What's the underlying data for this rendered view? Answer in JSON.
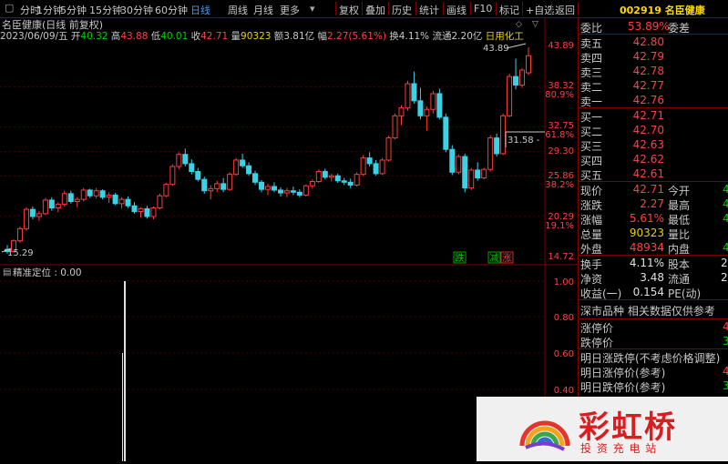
{
  "toolbar": {
    "periods": [
      "分时",
      "1分钟",
      "5分钟",
      "15分钟",
      "30分钟",
      "60分钟",
      "日线",
      "周线",
      "月线",
      "更多"
    ],
    "active_period": "日线",
    "tools": [
      "复权",
      "叠加",
      "历史",
      "统计",
      "画线",
      "F10",
      "标记",
      "+自选",
      "返回"
    ]
  },
  "stock": {
    "code": "002919",
    "name": "名臣健康"
  },
  "chart": {
    "title": "名臣健康(日线 前复权)",
    "info": {
      "date": "2023/06/09/五",
      "open_label": "开",
      "open": "40.32",
      "high_label": "高",
      "high": "43.88",
      "low_label": "低",
      "low": "40.01",
      "close_label": "收",
      "close": "42.71",
      "vol_label": "量",
      "vol": "90323",
      "amount_label": "额",
      "amount": "3.81亿",
      "change_label": "幅",
      "change": "2.27(5.61%)",
      "turnover_label": "换",
      "turnover": "4.11%",
      "float_label": "流通",
      "float": "2.20亿",
      "sector": "日用化工"
    },
    "price_axis": [
      "43.89",
      "38.32",
      "80.9%",
      "32.75",
      "61.8%",
      "29.30",
      "25.86",
      "38.2%",
      "20.29",
      "19.1%",
      "14.72"
    ],
    "high_marker": "43.89",
    "low_marker": "15.29",
    "crosshair_label": "31.58 - ",
    "tags": [
      "跌",
      "减",
      "涨"
    ],
    "indicator_title": "精准定位 : 0.00",
    "indicator_axis": [
      "1.00",
      "0.80",
      "0.60",
      "0.40"
    ]
  },
  "chart_data": {
    "type": "candlestick",
    "y_range": [
      14.72,
      43.89
    ],
    "candles": [
      [
        15.6,
        16.2,
        15.0,
        15.3
      ],
      [
        15.3,
        17.0,
        15.2,
        16.8
      ],
      [
        16.8,
        18.8,
        16.5,
        18.5
      ],
      [
        18.5,
        21.5,
        18.2,
        21.2
      ],
      [
        21.2,
        21.6,
        19.8,
        20.2
      ],
      [
        20.2,
        21.0,
        19.6,
        20.6
      ],
      [
        20.6,
        22.8,
        20.4,
        22.5
      ],
      [
        22.5,
        22.9,
        21.0,
        21.4
      ],
      [
        21.4,
        22.2,
        20.8,
        21.9
      ],
      [
        21.9,
        23.8,
        21.6,
        23.4
      ],
      [
        23.4,
        23.8,
        22.0,
        22.3
      ],
      [
        22.3,
        22.9,
        21.5,
        22.6
      ],
      [
        22.6,
        24.2,
        22.3,
        23.9
      ],
      [
        23.9,
        24.1,
        22.8,
        23.1
      ],
      [
        23.1,
        24.2,
        22.7,
        23.8
      ],
      [
        23.8,
        24.0,
        22.6,
        22.9
      ],
      [
        22.9,
        23.6,
        22.1,
        23.2
      ],
      [
        23.2,
        23.5,
        21.8,
        22.0
      ],
      [
        22.0,
        22.9,
        21.3,
        22.6
      ],
      [
        22.6,
        23.0,
        21.4,
        21.7
      ],
      [
        21.7,
        22.2,
        20.6,
        20.9
      ],
      [
        20.9,
        21.5,
        20.1,
        21.3
      ],
      [
        21.3,
        21.7,
        19.9,
        20.2
      ],
      [
        20.2,
        21.6,
        19.8,
        21.4
      ],
      [
        21.4,
        23.4,
        21.2,
        23.1
      ],
      [
        23.1,
        24.9,
        22.9,
        24.7
      ],
      [
        24.7,
        27.5,
        24.5,
        27.2
      ],
      [
        27.2,
        29.2,
        26.8,
        28.9
      ],
      [
        28.9,
        29.7,
        27.2,
        27.6
      ],
      [
        27.6,
        28.2,
        26.1,
        26.5
      ],
      [
        26.5,
        27.0,
        25.1,
        25.4
      ],
      [
        25.4,
        25.8,
        23.4,
        23.8
      ],
      [
        23.8,
        24.6,
        22.6,
        24.1
      ],
      [
        24.1,
        25.2,
        23.6,
        24.8
      ],
      [
        24.8,
        25.6,
        23.6,
        24.0
      ],
      [
        24.0,
        26.4,
        23.8,
        26.1
      ],
      [
        26.1,
        28.4,
        25.9,
        28.1
      ],
      [
        28.1,
        29.0,
        27.0,
        27.3
      ],
      [
        27.3,
        27.8,
        25.9,
        26.2
      ],
      [
        26.2,
        26.6,
        24.6,
        25.0
      ],
      [
        25.0,
        25.3,
        23.6,
        24.0
      ],
      [
        24.0,
        24.8,
        23.2,
        24.4
      ],
      [
        24.4,
        25.0,
        23.6,
        23.9
      ],
      [
        23.9,
        24.3,
        23.0,
        23.5
      ],
      [
        23.5,
        24.2,
        22.9,
        23.8
      ],
      [
        23.8,
        24.4,
        23.2,
        23.6
      ],
      [
        23.6,
        24.0,
        22.9,
        23.2
      ],
      [
        23.2,
        24.7,
        23.0,
        24.5
      ],
      [
        24.5,
        25.4,
        24.1,
        25.1
      ],
      [
        25.1,
        26.8,
        24.9,
        26.5
      ],
      [
        26.5,
        26.9,
        25.4,
        25.7
      ],
      [
        25.7,
        26.2,
        25.1,
        25.9
      ],
      [
        25.9,
        26.2,
        24.9,
        25.2
      ],
      [
        25.2,
        25.6,
        24.6,
        25.0
      ],
      [
        25.0,
        25.5,
        24.2,
        24.6
      ],
      [
        24.6,
        26.4,
        24.4,
        26.1
      ],
      [
        26.1,
        28.8,
        25.9,
        28.4
      ],
      [
        28.4,
        29.2,
        27.2,
        27.6
      ],
      [
        27.6,
        28.1,
        25.9,
        26.2
      ],
      [
        26.2,
        28.4,
        26.0,
        28.1
      ],
      [
        28.1,
        31.5,
        27.9,
        31.2
      ],
      [
        31.2,
        34.6,
        31.0,
        34.3
      ],
      [
        34.3,
        35.8,
        33.0,
        35.4
      ],
      [
        35.4,
        39.2,
        35.0,
        38.8
      ],
      [
        38.8,
        40.5,
        36.0,
        36.4
      ],
      [
        36.4,
        38.2,
        33.8,
        34.3
      ],
      [
        34.3,
        35.6,
        32.2,
        35.2
      ],
      [
        35.2,
        37.8,
        34.6,
        37.4
      ],
      [
        37.4,
        38.1,
        33.8,
        34.1
      ],
      [
        34.1,
        34.6,
        29.2,
        29.6
      ],
      [
        29.6,
        30.2,
        26.0,
        26.4
      ],
      [
        26.4,
        28.9,
        26.1,
        28.6
      ],
      [
        28.6,
        29.0,
        23.6,
        24.2
      ],
      [
        24.2,
        27.0,
        23.9,
        26.7
      ],
      [
        26.7,
        27.8,
        25.2,
        25.6
      ],
      [
        25.6,
        27.0,
        25.4,
        26.8
      ],
      [
        26.8,
        31.6,
        26.5,
        31.2
      ],
      [
        31.2,
        31.8,
        28.6,
        29.0
      ],
      [
        29.0,
        34.6,
        28.8,
        34.3
      ],
      [
        34.3,
        40.2,
        34.1,
        39.8
      ],
      [
        39.8,
        42.3,
        38.0,
        38.6
      ],
      [
        38.6,
        41.0,
        38.2,
        40.7
      ],
      [
        40.32,
        43.88,
        40.01,
        42.71
      ]
    ]
  },
  "panel": {
    "weibi_label": "委比",
    "weibi": "53.89%",
    "weicha_label": "委差",
    "asks": [
      {
        "label": "卖五",
        "price": "42.80"
      },
      {
        "label": "卖四",
        "price": "42.79"
      },
      {
        "label": "卖三",
        "price": "42.78"
      },
      {
        "label": "卖二",
        "price": "42.77"
      },
      {
        "label": "卖一",
        "price": "42.76"
      }
    ],
    "bids": [
      {
        "label": "买一",
        "price": "42.71"
      },
      {
        "label": "买二",
        "price": "42.70"
      },
      {
        "label": "买三",
        "price": "42.63"
      },
      {
        "label": "买四",
        "price": "42.62"
      },
      {
        "label": "买五",
        "price": "42.61"
      }
    ],
    "stats": [
      {
        "l1": "现价",
        "v1": "42.71",
        "l2": "今开",
        "v2": "4"
      },
      {
        "l1": "涨跌",
        "v1": "2.27",
        "l2": "最高",
        "v2": "4"
      },
      {
        "l1": "涨幅",
        "v1": "5.61%",
        "l2": "最低",
        "v2": "4"
      },
      {
        "l1": "总量",
        "v1": "90323",
        "l2": "量比",
        "v2": ""
      },
      {
        "l1": "外盘",
        "v1": "48934",
        "l2": "内盘",
        "v2": "4"
      }
    ],
    "stats2": [
      {
        "l1": "换手",
        "v1": "4.11%",
        "l2": "股本",
        "v2": "2."
      },
      {
        "l1": "净资",
        "v1": "3.48",
        "l2": "流通",
        "v2": "2."
      },
      {
        "l1": "收益(一)",
        "v1": "0.154",
        "l2": "PE(动)",
        "v2": ""
      }
    ],
    "notice": "深市品种  相关数据仅供参考",
    "limit_rows": [
      {
        "label": "涨停价",
        "value": "4"
      },
      {
        "label": "跌停价",
        "value": "3"
      }
    ],
    "tomorrow_rows": [
      "明日涨跌停(不考虑价格调整)",
      "明日涨停价(参考)",
      "明日跌停价(参考)"
    ],
    "tomorrow_values": [
      "4",
      "3"
    ]
  },
  "watermark": {
    "name": "彩虹桥",
    "sub": "投 资 充 电 站"
  }
}
